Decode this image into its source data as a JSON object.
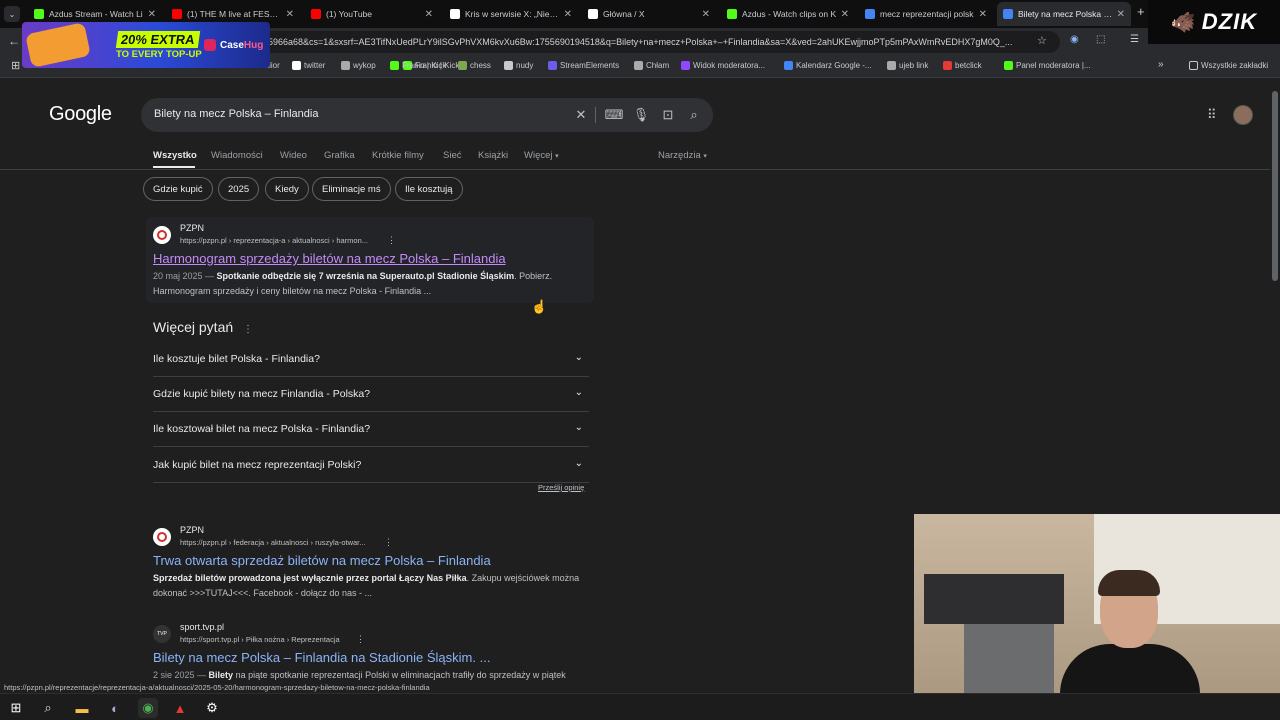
{
  "browser": {
    "tabs": [
      {
        "title": "Azdus Stream - Watch Li",
        "icon": "kick-icon",
        "color": "#53fc18"
      },
      {
        "title": "(1) THE M live at FESTIVAL",
        "icon": "youtube-icon",
        "color": "#ff0000"
      },
      {
        "title": "(1) YouTube",
        "icon": "youtube-icon",
        "color": "#ff0000"
      },
      {
        "title": "Kris w serwisie X: „Niech g",
        "icon": "x-icon",
        "color": "#ffffff"
      },
      {
        "title": "Główna / X",
        "icon": "x-icon",
        "color": "#ffffff"
      },
      {
        "title": "Azdus - Watch clips on K",
        "icon": "kick-icon",
        "color": "#53fc18"
      },
      {
        "title": "mecz reprezentacji polsk",
        "icon": "google-icon",
        "color": "#4285f4"
      },
      {
        "title": "Bilety na mecz Polska – Fi",
        "icon": "google-icon",
        "color": "#4285f4"
      }
    ],
    "address": "5966a68&cs=1&sxsrf=AE3TifNxUedPLrY9ilSGvPhVXM6kvXu6Bw:1755690194518&q=Bilety+na+mecz+Polska+–+Finlandia&sa=X&ved=2ahUKEwjjmoPTp5mPAxWmRvEDHX7gM0Q_...",
    "bookmarks": [
      {
        "label": "...alior",
        "icon": "bookmark-icon",
        "color": "#888888"
      },
      {
        "label": "Franio | Kick",
        "icon": "kick-icon",
        "color": "#53fc18"
      },
      {
        "label": "twitter",
        "icon": "x-icon",
        "color": "#ffffff"
      },
      {
        "label": "wykop",
        "icon": "wykop-icon",
        "color": "#aaaaaa"
      },
      {
        "label": "Franio | Kick",
        "icon": "kick-icon",
        "color": "#53fc18"
      },
      {
        "label": "chess",
        "icon": "chess-icon",
        "color": "#7fa650"
      },
      {
        "label": "nudy",
        "icon": "folder-icon",
        "color": "#c7c9cd"
      },
      {
        "label": "StreamElements",
        "icon": "streamelements-icon",
        "color": "#6c5ce7"
      },
      {
        "label": "Chłam",
        "icon": "globe-icon",
        "color": "#aaaaaa"
      },
      {
        "label": "Widok moderatora...",
        "icon": "twitch-icon",
        "color": "#9146ff"
      },
      {
        "label": "Kalendarz Google -...",
        "icon": "calendar-icon",
        "color": "#4285f4"
      },
      {
        "label": "ujeb link",
        "icon": "globe-icon",
        "color": "#aaaaaa"
      },
      {
        "label": "betclick",
        "icon": "betclic-icon",
        "color": "#e53935"
      },
      {
        "label": "Panel moderatora |...",
        "icon": "kick-icon",
        "color": "#53fc18"
      }
    ],
    "all_bookmarks": "Wszystkie zakładki"
  },
  "overlays": {
    "promo_text": "20% EXTRA",
    "promo_sub": "TO EVERY TOP-UP",
    "promo_brand": "Case",
    "promo_brand2": "Hug",
    "dzik": "DZIK"
  },
  "google": {
    "logo": "Google",
    "query": "Bilety na mecz Polska – Finlandia",
    "tabs": [
      "Wszystko",
      "Wiadomości",
      "Wideo",
      "Grafika",
      "Krótkie filmy",
      "Sieć",
      "Książki",
      "Więcej"
    ],
    "tools": "Narzędzia",
    "chips": [
      "Gdzie kupić",
      "2025",
      "Kiedy",
      "Eliminacje mś",
      "Ile kosztują"
    ],
    "results": [
      {
        "site": "PZPN",
        "url": "https://pzpn.pl › reprezentacja-a › aktualnosci › harmon...",
        "title": "Harmonogram sprzedaży biletów na mecz Polska – Finlandia",
        "date": "20 maj 2025 — ",
        "snippet_bold": "Spotkanie odbędzie się 7 września na Superauto.pl Stadionie Śląskim",
        "snippet_rest": ". Pobierz. Harmonogram sprzedaży i ceny biletów na mecz Polska - Finlandia ..."
      },
      {
        "site": "PZPN",
        "url": "https://pzpn.pl › federacja › aktualnosci › ruszyla-otwar...",
        "title": "Trwa otwarta sprzedaż biletów na mecz Polska – Finlandia",
        "snippet_bold": "Sprzedaż biletów prowadzona jest wyłącznie przez portal Łączy Nas Piłka",
        "snippet_rest": ". Zakupu wejściówek można dokonać >>>TUTAJ<<<. Facebook - dołącz do nas - ..."
      },
      {
        "site": "sport.tvp.pl",
        "url": "https://sport.tvp.pl › Piłka nożna › Reprezentacja",
        "title": "Bilety na mecz Polska – Finlandia na Stadionie Śląskim. ...",
        "date": "2 sie 2025 — ",
        "snippet_bold": "Bilety",
        "snippet_rest": " na piąte spotkanie reprezentacji Polski w eliminacjach trafiły do sprzedaży w piątek"
      }
    ],
    "paa_title": "Więcej pytań",
    "paa": [
      "Ile kosztuje bilet Polska - Finlandia?",
      "Gdzie kupić bilety na mecz Finlandia - Polska?",
      "Ile kosztował bilet na mecz Polska - Finlandia?",
      "Jak kupić bilet na mecz reprezentacji Polski?"
    ],
    "feedback": "Prześlij opinię"
  },
  "status_url": "https://pzpn.pl/reprezentacje/reprezentacja-a/aktualnosci/2025-05-20/harmonogram-sprzedazy-biletow-na-mecz-polska-finlandia"
}
